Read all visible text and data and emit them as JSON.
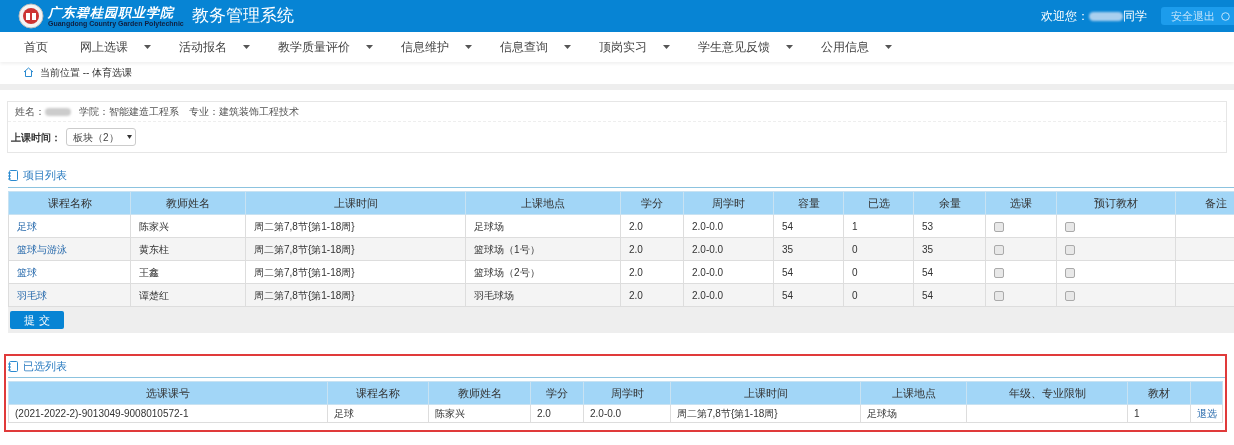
{
  "header": {
    "school_name": "广东碧桂园职业学院",
    "school_name_en": "Guangdong Country Garden Polytechnic",
    "system_title": "教务管理系统",
    "welcome": "欢迎您：",
    "welcome_suffix": "同学",
    "logout": "安全退出"
  },
  "nav": [
    {
      "label": "首页",
      "dropdown": false
    },
    {
      "label": "网上选课",
      "dropdown": true
    },
    {
      "label": "活动报名",
      "dropdown": true
    },
    {
      "label": "教学质量评价",
      "dropdown": true
    },
    {
      "label": "信息维护",
      "dropdown": true
    },
    {
      "label": "信息查询",
      "dropdown": true
    },
    {
      "label": "顶岗实习",
      "dropdown": true
    },
    {
      "label": "学生意见反馈",
      "dropdown": true
    },
    {
      "label": "公用信息",
      "dropdown": true
    }
  ],
  "breadcrumb": "当前位置 -- 体育选课",
  "student": {
    "name_label": "姓名：",
    "college": "学院：智能建造工程系",
    "major": "专业：建筑装饰工程技术"
  },
  "filter": {
    "label": "上课时间：",
    "value": "板块（2）"
  },
  "course_list": {
    "title": "项目列表",
    "columns": [
      "课程名称",
      "教师姓名",
      "上课时间",
      "上课地点",
      "学分",
      "周学时",
      "容量",
      "已选",
      "余量",
      "选课",
      "预订教材",
      "备注"
    ],
    "rows": [
      {
        "name": "足球",
        "teacher": "陈家兴",
        "time": "周二第7,8节{第1-18周}",
        "place": "足球场",
        "credit": "2.0",
        "hours": "2.0-0.0",
        "capacity": "54",
        "selected_count": "1",
        "remaining": "53",
        "choose": false,
        "order_book": false
      },
      {
        "name": "篮球与游泳",
        "teacher": "黄东柱",
        "time": "周二第7,8节{第1-18周}",
        "place": "篮球场（1号）",
        "credit": "2.0",
        "hours": "2.0-0.0",
        "capacity": "35",
        "selected_count": "0",
        "remaining": "35",
        "choose": false,
        "order_book": false
      },
      {
        "name": "篮球",
        "teacher": "王鑫",
        "time": "周二第7,8节{第1-18周}",
        "place": "篮球场（2号）",
        "credit": "2.0",
        "hours": "2.0-0.0",
        "capacity": "54",
        "selected_count": "0",
        "remaining": "54",
        "choose": false,
        "order_book": false
      },
      {
        "name": "羽毛球",
        "teacher": "谭楚红",
        "time": "周二第7,8节{第1-18周}",
        "place": "羽毛球场",
        "credit": "2.0",
        "hours": "2.0-0.0",
        "capacity": "54",
        "selected_count": "0",
        "remaining": "54",
        "choose": false,
        "order_book": false
      }
    ],
    "submit": "提 交"
  },
  "chosen_list": {
    "title": "已选列表",
    "columns": [
      "选课课号",
      "课程名称",
      "教师姓名",
      "学分",
      "周学时",
      "上课时间",
      "上课地点",
      "年级、专业限制",
      "教材"
    ],
    "rows": [
      {
        "code": "(2021-2022-2)-9013049-9008010572-1",
        "name": "足球",
        "teacher": "陈家兴",
        "credit": "2.0",
        "hours": "2.0-0.0",
        "time": "周二第7,8节{第1-18周}",
        "place": "足球场",
        "book": "1",
        "action": "退选"
      }
    ]
  }
}
